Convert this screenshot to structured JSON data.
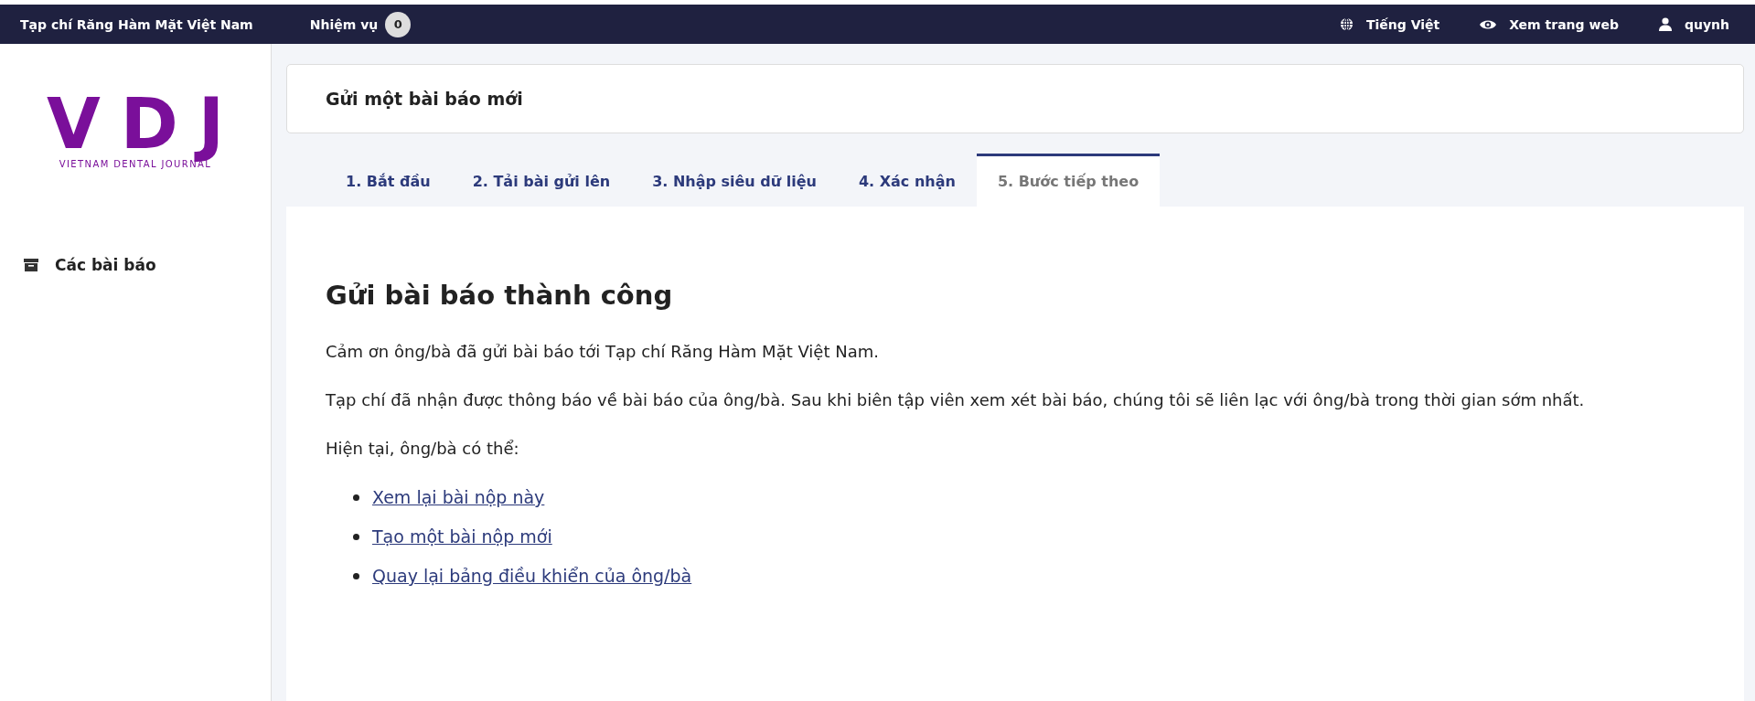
{
  "top_bar": {
    "site_title": "Tạp chí Răng Hàm Mặt Việt Nam",
    "tasks": {
      "label": "Nhiệm vụ",
      "count": "0"
    },
    "right_items": [
      {
        "kind": "language",
        "label": "Tiếng Việt"
      },
      {
        "kind": "view",
        "label": "Xem trang web"
      },
      {
        "kind": "user",
        "label": "quynh"
      }
    ]
  },
  "sidebar": {
    "logo": {
      "letters": "VDJ",
      "tagline": "VIETNAM DENTAL JOURNAL"
    },
    "items": [
      {
        "label": "Các bài báo"
      }
    ]
  },
  "page_header": {
    "title": "Gửi một bài báo mới"
  },
  "tabs": [
    {
      "label": "1. Bắt đầu",
      "selected": false
    },
    {
      "label": "2. Tải bài gửi lên",
      "selected": false
    },
    {
      "label": "3. Nhập siêu dữ liệu",
      "selected": false
    },
    {
      "label": "4. Xác nhận",
      "selected": false
    },
    {
      "label": "5. Bước tiếp theo",
      "selected": true
    }
  ],
  "content": {
    "heading": "Gửi bài báo thành công",
    "paragraphs": [
      "Cảm ơn ông/bà đã gửi bài báo tới Tạp chí Răng Hàm Mặt Việt Nam.",
      "Tạp chí đã nhận được thông báo về bài báo của ông/bà. Sau khi biên tập viên xem xét bài báo, chúng tôi sẽ liên lạc với ông/bà trong thời gian sớm nhất.",
      "Hiện tại, ông/bà có thể:"
    ],
    "links": [
      "Xem lại bài nộp này",
      "Tạo một bài nộp mới",
      "Quay lại bảng điều khiển của ông/bà"
    ]
  }
}
